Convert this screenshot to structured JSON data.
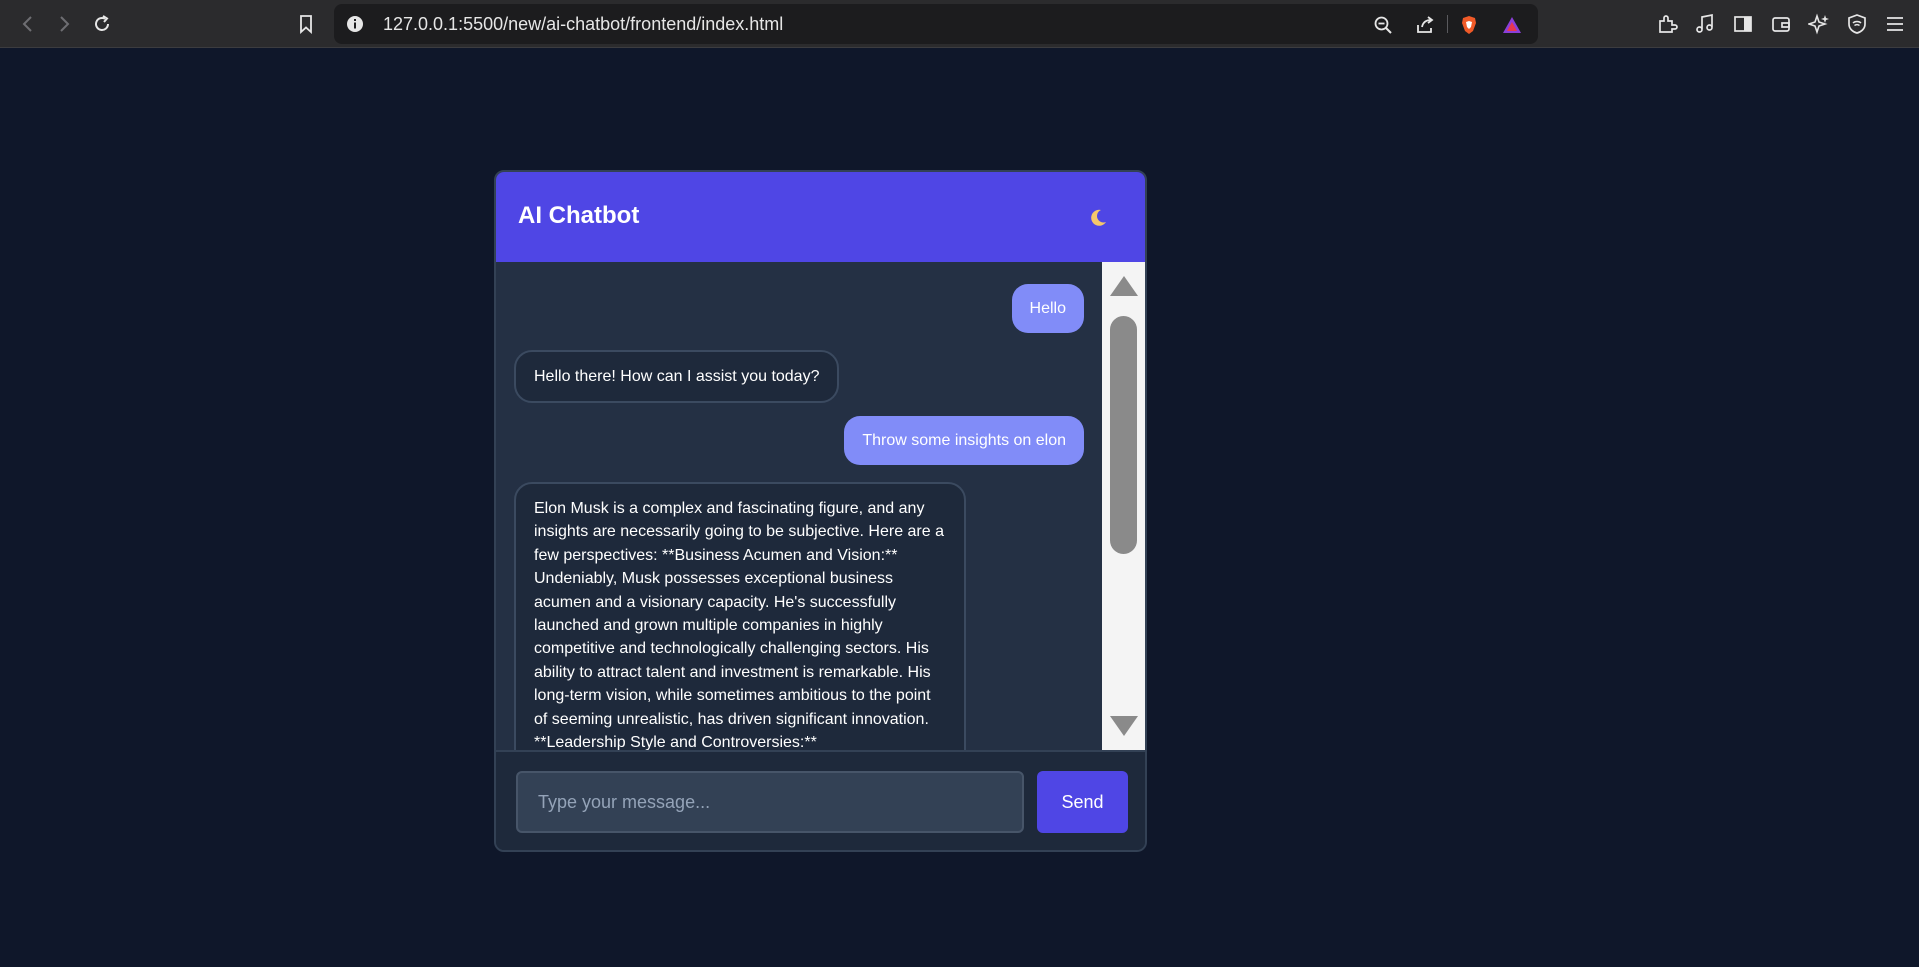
{
  "browser": {
    "url": "127.0.0.1:5500/new/ai-chatbot/frontend/index.html"
  },
  "chat": {
    "title": "AI Chatbot",
    "theme_toggle": "🌙",
    "messages": [
      {
        "role": "user",
        "text": "Hello"
      },
      {
        "role": "bot",
        "text": "Hello there! How can I assist you today?"
      },
      {
        "role": "user",
        "text": "Throw some insights on elon"
      },
      {
        "role": "bot",
        "text": "Elon Musk is a complex and fascinating figure, and any insights are necessarily going to be subjective. Here are a few perspectives: **Business Acumen and Vision:** Undeniably, Musk possesses exceptional business acumen and a visionary capacity. He's successfully launched and grown multiple companies in highly competitive and technologically challenging sectors. His ability to attract talent and investment is remarkable. His long-term vision, while sometimes ambitious to the point of seeming unrealistic, has driven significant innovation. **Leadership Style and Controversies:**"
      }
    ],
    "input_placeholder": "Type your message...",
    "send_label": "Send"
  }
}
